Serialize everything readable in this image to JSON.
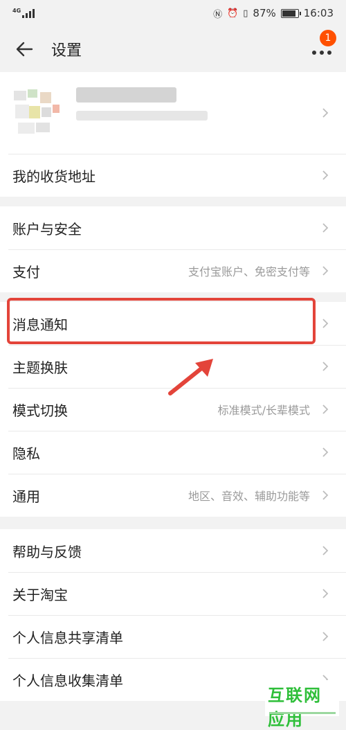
{
  "status_bar": {
    "network": "4G",
    "battery": "87%",
    "time": "16:03",
    "battery_level": 0.87
  },
  "header": {
    "title": "设置",
    "badge_count": "1"
  },
  "menu": {
    "address": "我的收货地址",
    "account_security": "账户与安全",
    "payment": {
      "label": "支付",
      "detail": "支付宝账户、免密支付等"
    },
    "notifications": "消息通知",
    "theme": "主题换肤",
    "mode": {
      "label": "模式切换",
      "detail": "标准模式/长辈模式"
    },
    "privacy": "隐私",
    "general": {
      "label": "通用",
      "detail": "地区、音效、辅助功能等"
    },
    "help": "帮助与反馈",
    "about": "关于淘宝",
    "info_share": "个人信息共享清单",
    "info_collect": "个人信息收集清单"
  },
  "watermark": {
    "text": "互联网应用"
  },
  "colors": {
    "accent": "#ff5000",
    "highlight": "#e3443a",
    "watermark": "#2fbf3a"
  }
}
